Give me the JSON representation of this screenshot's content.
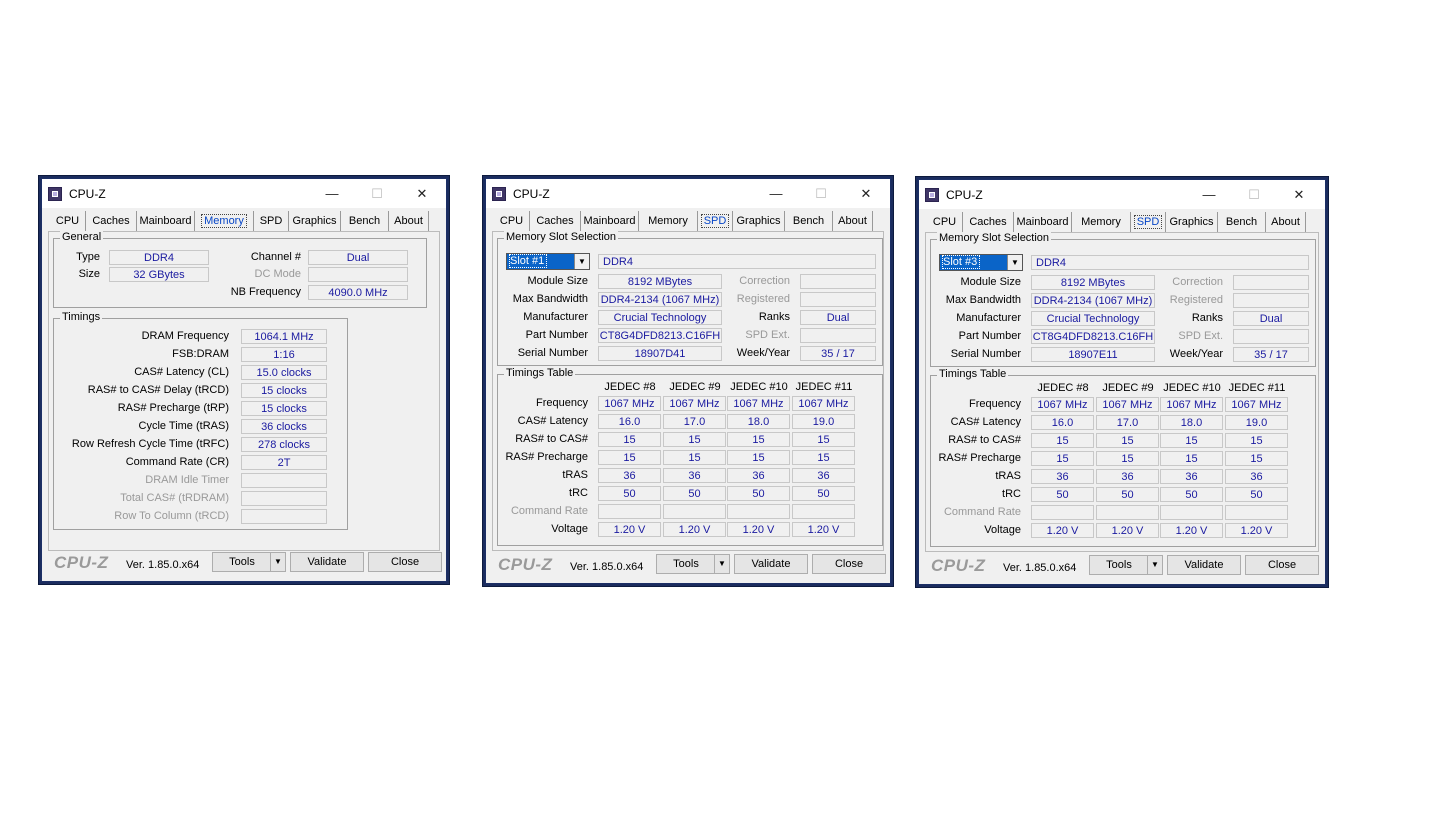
{
  "common": {
    "title": "CPU-Z",
    "minimize_glyph": "—",
    "maximize_glyph": "☐",
    "close_glyph": "✕",
    "tabs": [
      "CPU",
      "Caches",
      "Mainboard",
      "Memory",
      "SPD",
      "Graphics",
      "Bench",
      "About"
    ],
    "logo": "CPU-Z",
    "version": "Ver. 1.85.0.x64",
    "tools_label": "Tools",
    "validate_label": "Validate",
    "close_label": "Close",
    "dropdown_glyph": "▼"
  },
  "memory_window": {
    "active_tab": "Memory",
    "general": {
      "title": "General",
      "type_label": "Type",
      "type_value": "DDR4",
      "size_label": "Size",
      "size_value": "32 GBytes",
      "channel_label": "Channel #",
      "channel_value": "Dual",
      "dcmode_label": "DC Mode",
      "dcmode_value": "",
      "nbfreq_label": "NB Frequency",
      "nbfreq_value": "4090.0 MHz"
    },
    "timings": {
      "title": "Timings",
      "rows": [
        {
          "label": "DRAM Frequency",
          "value": "1064.1 MHz",
          "enabled": true
        },
        {
          "label": "FSB:DRAM",
          "value": "1:16",
          "enabled": true
        },
        {
          "label": "CAS# Latency (CL)",
          "value": "15.0 clocks",
          "enabled": true
        },
        {
          "label": "RAS# to CAS# Delay (tRCD)",
          "value": "15 clocks",
          "enabled": true
        },
        {
          "label": "RAS# Precharge (tRP)",
          "value": "15 clocks",
          "enabled": true
        },
        {
          "label": "Cycle Time (tRAS)",
          "value": "36 clocks",
          "enabled": true
        },
        {
          "label": "Row Refresh Cycle Time (tRFC)",
          "value": "278 clocks",
          "enabled": true
        },
        {
          "label": "Command Rate (CR)",
          "value": "2T",
          "enabled": true
        },
        {
          "label": "DRAM Idle Timer",
          "value": "",
          "enabled": false
        },
        {
          "label": "Total CAS# (tRDRAM)",
          "value": "",
          "enabled": false
        },
        {
          "label": "Row To Column (tRCD)",
          "value": "",
          "enabled": false
        }
      ]
    }
  },
  "spd_windows": [
    {
      "active_tab": "SPD",
      "slot_group_title": "Memory Slot Selection",
      "slot": "Slot #1",
      "mem_type": "DDR4",
      "module_size_label": "Module Size",
      "module_size": "8192 MBytes",
      "max_bw_label": "Max Bandwidth",
      "max_bw": "DDR4-2134 (1067 MHz)",
      "manufacturer_label": "Manufacturer",
      "manufacturer": "Crucial Technology",
      "part_label": "Part Number",
      "part": "CT8G4DFD8213.C16FH",
      "serial_label": "Serial Number",
      "serial": "18907D41",
      "correction_label": "Correction",
      "correction": "",
      "registered_label": "Registered",
      "registered": "",
      "ranks_label": "Ranks",
      "ranks": "Dual",
      "spdext_label": "SPD Ext.",
      "spdext": "",
      "weekyear_label": "Week/Year",
      "weekyear": "35 / 17",
      "timings_title": "Timings Table",
      "columns": [
        "JEDEC #8",
        "JEDEC #9",
        "JEDEC #10",
        "JEDEC #11"
      ],
      "rows": [
        {
          "label": "Frequency",
          "values": [
            "1067 MHz",
            "1067 MHz",
            "1067 MHz",
            "1067 MHz"
          ],
          "enabled": true
        },
        {
          "label": "CAS# Latency",
          "values": [
            "16.0",
            "17.0",
            "18.0",
            "19.0"
          ],
          "enabled": true
        },
        {
          "label": "RAS# to CAS#",
          "values": [
            "15",
            "15",
            "15",
            "15"
          ],
          "enabled": true
        },
        {
          "label": "RAS# Precharge",
          "values": [
            "15",
            "15",
            "15",
            "15"
          ],
          "enabled": true
        },
        {
          "label": "tRAS",
          "values": [
            "36",
            "36",
            "36",
            "36"
          ],
          "enabled": true
        },
        {
          "label": "tRC",
          "values": [
            "50",
            "50",
            "50",
            "50"
          ],
          "enabled": true
        },
        {
          "label": "Command Rate",
          "values": [
            "",
            "",
            "",
            ""
          ],
          "enabled": false
        },
        {
          "label": "Voltage",
          "values": [
            "1.20 V",
            "1.20 V",
            "1.20 V",
            "1.20 V"
          ],
          "enabled": true
        }
      ]
    },
    {
      "active_tab": "SPD",
      "slot_group_title": "Memory Slot Selection",
      "slot": "Slot #3",
      "mem_type": "DDR4",
      "module_size_label": "Module Size",
      "module_size": "8192 MBytes",
      "max_bw_label": "Max Bandwidth",
      "max_bw": "DDR4-2134 (1067 MHz)",
      "manufacturer_label": "Manufacturer",
      "manufacturer": "Crucial Technology",
      "part_label": "Part Number",
      "part": "CT8G4DFD8213.C16FH",
      "serial_label": "Serial Number",
      "serial": "18907E11",
      "correction_label": "Correction",
      "correction": "",
      "registered_label": "Registered",
      "registered": "",
      "ranks_label": "Ranks",
      "ranks": "Dual",
      "spdext_label": "SPD Ext.",
      "spdext": "",
      "weekyear_label": "Week/Year",
      "weekyear": "35 / 17",
      "timings_title": "Timings Table",
      "columns": [
        "JEDEC #8",
        "JEDEC #9",
        "JEDEC #10",
        "JEDEC #11"
      ],
      "rows": [
        {
          "label": "Frequency",
          "values": [
            "1067 MHz",
            "1067 MHz",
            "1067 MHz",
            "1067 MHz"
          ],
          "enabled": true
        },
        {
          "label": "CAS# Latency",
          "values": [
            "16.0",
            "17.0",
            "18.0",
            "19.0"
          ],
          "enabled": true
        },
        {
          "label": "RAS# to CAS#",
          "values": [
            "15",
            "15",
            "15",
            "15"
          ],
          "enabled": true
        },
        {
          "label": "RAS# Precharge",
          "values": [
            "15",
            "15",
            "15",
            "15"
          ],
          "enabled": true
        },
        {
          "label": "tRAS",
          "values": [
            "36",
            "36",
            "36",
            "36"
          ],
          "enabled": true
        },
        {
          "label": "tRC",
          "values": [
            "50",
            "50",
            "50",
            "50"
          ],
          "enabled": true
        },
        {
          "label": "Command Rate",
          "values": [
            "",
            "",
            "",
            ""
          ],
          "enabled": false
        },
        {
          "label": "Voltage",
          "values": [
            "1.20 V",
            "1.20 V",
            "1.20 V",
            "1.20 V"
          ],
          "enabled": true
        }
      ]
    }
  ]
}
